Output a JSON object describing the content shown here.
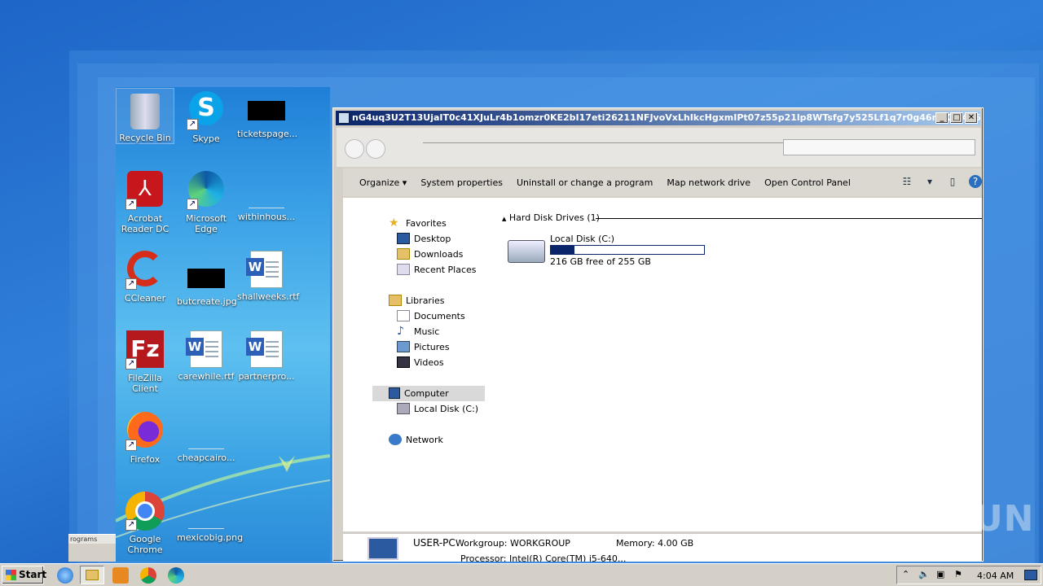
{
  "desktop": {
    "icons": [
      {
        "label": "Recycle Bin",
        "icon": "recycle-bin-icon"
      },
      {
        "label": "Skype",
        "icon": "skype-icon"
      },
      {
        "label": "ticketspage...",
        "icon": "image-file-icon"
      },
      {
        "label": "Acrobat Reader DC",
        "icon": "acrobat-icon"
      },
      {
        "label": "Microsoft Edge",
        "icon": "edge-icon"
      },
      {
        "label": "withinhous...",
        "icon": "file-icon"
      },
      {
        "label": "CCleaner",
        "icon": "ccleaner-icon"
      },
      {
        "label": "butcreate.jpg",
        "icon": "image-file-icon"
      },
      {
        "label": "shallweeks.rtf",
        "icon": "word-document-icon"
      },
      {
        "label": "FileZilla Client",
        "icon": "filezilla-icon"
      },
      {
        "label": "carewhile.rtf",
        "icon": "word-document-icon"
      },
      {
        "label": "partnerpro...",
        "icon": "word-document-icon"
      },
      {
        "label": "Firefox",
        "icon": "firefox-icon"
      },
      {
        "label": "cheapcairo...",
        "icon": "file-icon"
      },
      {
        "label": "Google Chrome",
        "icon": "chrome-icon"
      },
      {
        "label": "mexicobig.png",
        "icon": "file-icon"
      }
    ],
    "strip_label": "rograms"
  },
  "window": {
    "title": "nG4uq3U2T13UjaIT0c41XJuLr4b1omzr0KE2bI17eti26211NFJvoVxLhIkcHgxmIPt07z55p21lp8WTsfg7y525Lf1q7r0g46nsXUt426...",
    "toolbar": [
      "Organize",
      "System properties",
      "Uninstall or change a program",
      "Map network drive",
      "Open Control Panel"
    ],
    "nav": {
      "favorites": "Favorites",
      "desktop": "Desktop",
      "downloads": "Downloads",
      "recent": "Recent Places",
      "libraries": "Libraries",
      "documents": "Documents",
      "music": "Music",
      "pictures": "Pictures",
      "videos": "Videos",
      "computer": "Computer",
      "local_disk": "Local Disk (C:)",
      "network": "Network"
    },
    "group_label": "Hard Disk Drives (1)",
    "drive": {
      "name": "Local Disk (C:)",
      "free_text": "216 GB free of 255 GB",
      "used_fraction": 0.153
    },
    "details": {
      "computer_name": "USER-PC",
      "workgroup": "Workgroup: WORKGROUP",
      "memory": "Memory: 4.00 GB",
      "processor": "Processor: Intel(R) Core(TM) i5-640..."
    }
  },
  "taskbar": {
    "start": "Start",
    "time": "4:04 AM"
  },
  "watermark": "ANY RUN"
}
